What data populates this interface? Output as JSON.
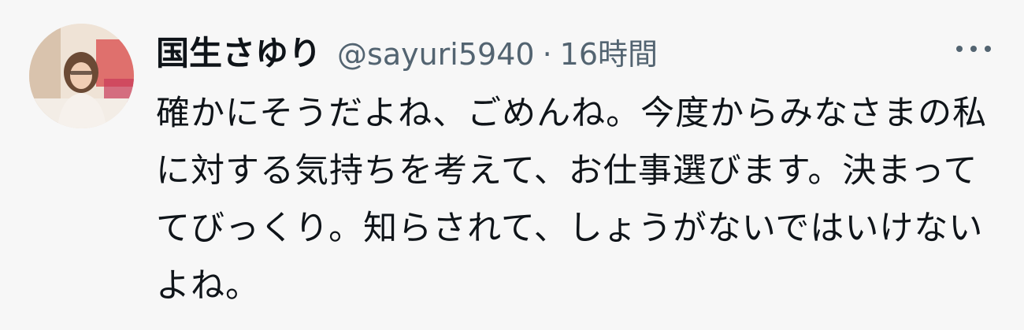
{
  "tweet": {
    "author": {
      "display_name": "国生さゆり",
      "handle": "@sayuri5940"
    },
    "separator": "·",
    "timestamp": "16時間",
    "text": "確かにそうだよね、ごめんね。今度からみなさまの私に対する気持ちを考えて、お仕事選びます。決まっててびっくり。知らされて、しょうがないではいけないよね。",
    "more_icon": "more-horizontal-icon"
  }
}
